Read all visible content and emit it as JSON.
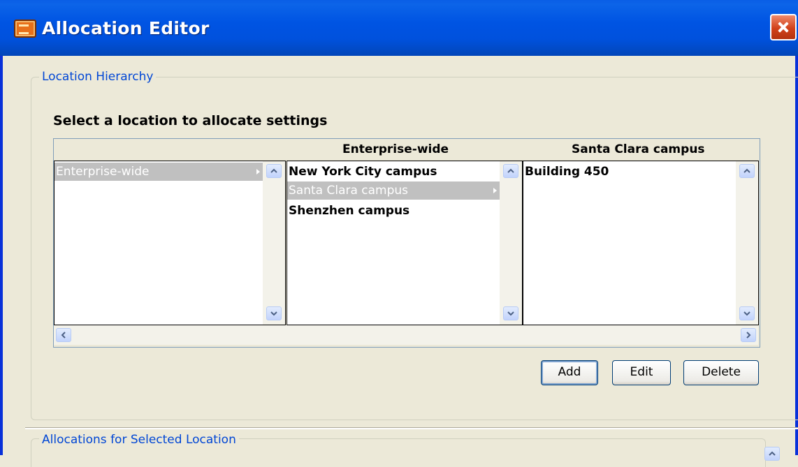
{
  "window": {
    "title": "Allocation Editor"
  },
  "group_hierarchy": {
    "legend": "Location Hierarchy"
  },
  "prompt": "Select a location to allocate settings",
  "browser": {
    "columns": [
      {
        "header": "",
        "items": [
          {
            "label": "Enterprise-wide",
            "selected": true,
            "has_children": true
          }
        ]
      },
      {
        "header": "Enterprise-wide",
        "items": [
          {
            "label": "New York City campus",
            "selected": false
          },
          {
            "label": "Santa Clara campus",
            "selected": true,
            "has_children": true
          },
          {
            "label": "Shenzhen campus",
            "selected": false
          }
        ]
      },
      {
        "header": "Santa Clara campus",
        "items": [
          {
            "label": "Building 450",
            "selected": false
          }
        ]
      }
    ]
  },
  "buttons": {
    "add": "Add",
    "edit": "Edit",
    "delete": "Delete"
  },
  "group_allocations": {
    "legend": "Allocations for Selected Location"
  },
  "colors": {
    "titlebar": "#0054e3",
    "legend": "#0046d5",
    "selection": "#c0c0c0"
  }
}
